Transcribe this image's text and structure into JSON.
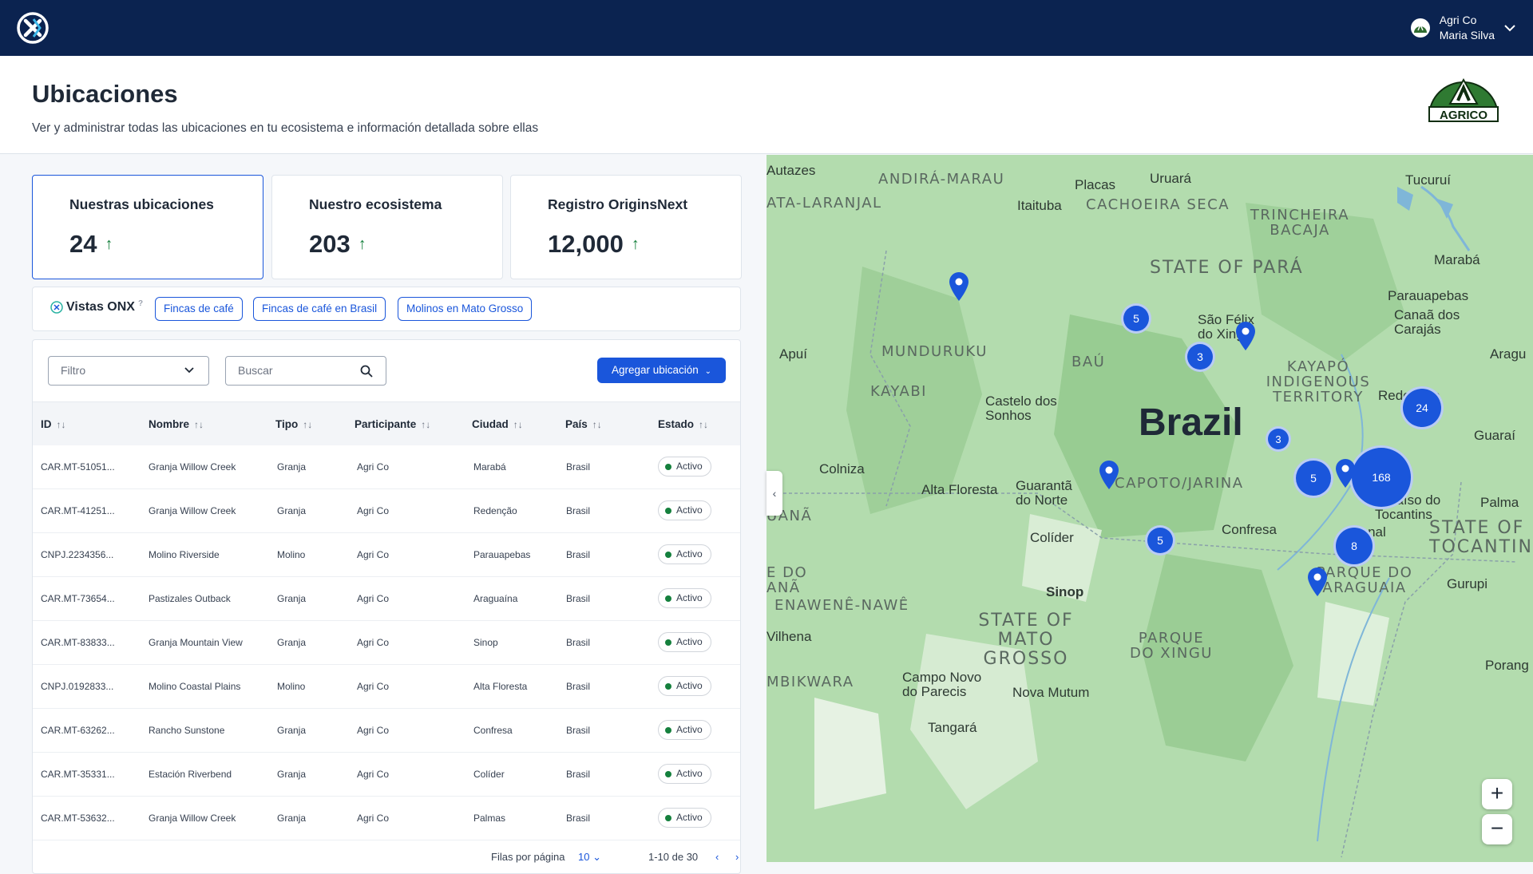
{
  "topbar": {
    "company": "Agri Co",
    "user": "Maria Silva"
  },
  "header": {
    "title": "Ubicaciones",
    "subtitle": "Ver y administrar todas las ubicaciones en tu ecosistema e información detallada sobre ellas",
    "brand_text": "AGRICO"
  },
  "stats": [
    {
      "label": "Nuestras ubicaciones",
      "value": "24"
    },
    {
      "label": "Nuestro ecosistema",
      "value": "203"
    },
    {
      "label": "Registro OriginsNext",
      "value": "12,000"
    }
  ],
  "views": {
    "label": "Vistas ONX",
    "chips": [
      "Fincas de café",
      "Fincas de café en Brasil",
      "Molinos en Mato Grosso"
    ]
  },
  "toolbar": {
    "filter_placeholder": "Filtro",
    "search_placeholder": "Buscar",
    "add_button": "Agregar ubicación"
  },
  "table": {
    "columns": [
      "ID",
      "Nombre",
      "Tipo",
      "Participante",
      "Ciudad",
      "País",
      "Estado"
    ],
    "rows": [
      [
        "CAR.MT-51051...",
        "Granja Willow Creek",
        "Granja",
        "Agri Co",
        "Marabá",
        "Brasil",
        "Activo"
      ],
      [
        "CAR.MT-41251...",
        "Granja Willow Creek",
        "Granja",
        "Agri Co",
        "Redenção",
        "Brasil",
        "Activo"
      ],
      [
        "CNPJ.2234356...",
        "Molino Riverside",
        "Molino",
        "Agri Co",
        "Parauapebas",
        "Brasil",
        "Activo"
      ],
      [
        "CAR.MT-73654...",
        "Pastizales Outback",
        "Granja",
        "Agri Co",
        "Araguaína",
        "Brasil",
        "Activo"
      ],
      [
        "CAR.MT-83833...",
        "Granja Mountain View",
        "Granja",
        "Agri Co",
        "Sinop",
        "Brasil",
        "Activo"
      ],
      [
        "CNPJ.0192833...",
        "Molino Coastal Plains",
        "Molino",
        "Agri Co",
        "Alta Floresta",
        "Brasil",
        "Activo"
      ],
      [
        "CAR.MT-63262...",
        "Rancho Sunstone",
        "Granja",
        "Agri Co",
        "Confresa",
        "Brasil",
        "Activo"
      ],
      [
        "CAR.MT-35331...",
        "Estación Riverbend",
        "Granja",
        "Agri Co",
        "Colíder",
        "Brasil",
        "Activo"
      ],
      [
        "CAR.MT-53632...",
        "Granja Willow Creek",
        "Granja",
        "Agri Co",
        "Palmas",
        "Brasil",
        "Activo"
      ]
    ]
  },
  "pagination": {
    "rows_label": "Filas por página",
    "rows_value": "10",
    "range": "1-10 de 30"
  },
  "map": {
    "country": "Brazil",
    "clusters": [
      "5",
      "3",
      "24",
      "3",
      "5",
      "168",
      "5",
      "8"
    ],
    "cities": [
      "Autazes",
      "Placas",
      "Uruará",
      "Tucuruí",
      "Itaituba",
      "Marabá",
      "Parauapebas",
      "Canaã dos Carajás",
      "Apuí",
      "São Félix do Xingu",
      "Aragu",
      "Redenção",
      "Castelo dos Sonhos",
      "Guaraí",
      "Colniza",
      "Alta Floresta",
      "Guarantã do Norte",
      "Confresa",
      "Paraíso do Tocantins",
      "Palma",
      "Colíder",
      "Sinop",
      "Gurupi",
      "Vilhena",
      "Campo Novo do Parecis",
      "Nova Mutum",
      "Tangará",
      "Porang",
      "do anal"
    ],
    "regions": [
      "ANDIRÁ-MARAU",
      "ATA-LARANJAL",
      "CACHOEIRA SECA",
      "TRINCHEIRA BACAJA",
      "MUNDURUKU",
      "BAÚ",
      "KAYAPÓ INDIGENOUS TERRITORY",
      "KAYABI",
      "CAPOTO/JARINA",
      "UANÃ",
      "E DO ANÃ",
      "ENAWENÊ-NAWÊ",
      "PARQUE DO ARAGUAIA",
      "PARQUE DO XINGU",
      "MBIKWARA"
    ],
    "states": [
      "STATE OF PARÁ",
      "STATE OF MATO GROSSO",
      "STATE OF TOCANTIN"
    ]
  }
}
